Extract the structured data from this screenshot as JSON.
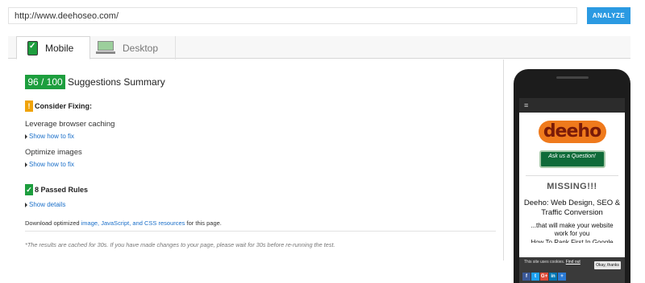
{
  "url_bar": {
    "value": "http://www.deehoseo.com/",
    "analyze_label": "ANALYZE"
  },
  "tabs": [
    {
      "label": "Mobile",
      "icon": "mobile-phone-icon",
      "active": true
    },
    {
      "label": "Desktop",
      "icon": "desktop-monitor-icon",
      "active": false
    }
  ],
  "summary": {
    "score": "96 / 100",
    "title": "Suggestions Summary"
  },
  "consider_fixing": {
    "icon_glyph": "!",
    "title": "Consider Fixing:",
    "rules": [
      {
        "name": "Leverage browser caching",
        "link": "Show how to fix"
      },
      {
        "name": "Optimize images",
        "link": "Show how to fix"
      }
    ]
  },
  "passed": {
    "icon_glyph": "✓",
    "title": "8 Passed Rules",
    "link": "Show details"
  },
  "download": {
    "prefix": "Download optimized ",
    "link": "image, JavaScript, and CSS resources",
    "suffix": " for this page."
  },
  "cache_note": "*The results are cached for 30s. If you have made changes to your page, please wait for 30s before re-running the test.",
  "preview": {
    "menu_glyph": "≡",
    "logo_text": "deeho",
    "ask_button": "Ask us a Question!",
    "missing_text": "MISSING!!!",
    "headline": "Deeho: Web Design, SEO & Traffic Conversion",
    "subline": "...that will make your website work for you",
    "cutoff_line": "How To Rank First In Google",
    "cookie_text": "This site uses cookies.",
    "cookie_link": "Find out",
    "okay_label": "Okay, thanks",
    "social": [
      {
        "glyph": "f",
        "color": "#3b5998"
      },
      {
        "glyph": "t",
        "color": "#1da1f2"
      },
      {
        "glyph": "G+",
        "color": "#dd4b39"
      },
      {
        "glyph": "in",
        "color": "#0077b5"
      },
      {
        "glyph": "+",
        "color": "#2b7ad4"
      }
    ]
  },
  "colors": {
    "accent": "#2b9ae2",
    "score_green": "#1d9e3e",
    "warning_orange": "#f0a30a",
    "link_blue": "#1a6fc9"
  }
}
